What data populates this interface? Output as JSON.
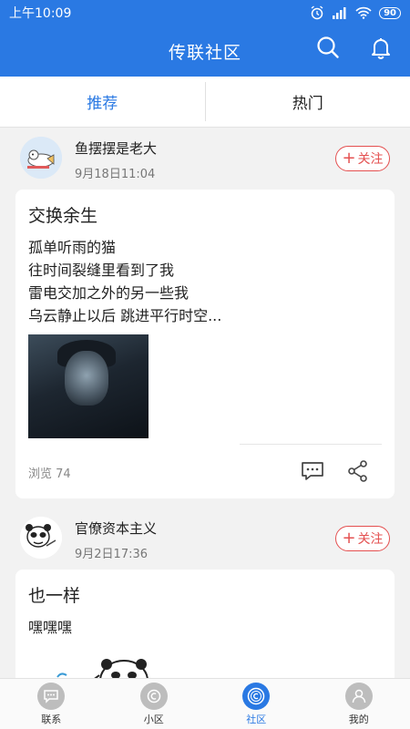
{
  "status": {
    "time": "上午10:09",
    "battery": "90"
  },
  "header": {
    "title": "传联社区"
  },
  "tabs": [
    {
      "label": "推荐",
      "active": true
    },
    {
      "label": "热门",
      "active": false
    }
  ],
  "posts": [
    {
      "author": "鱼摆摆是老大",
      "time": "9月18日11:04",
      "follow_label": "关注",
      "title": "交换余生",
      "lines": [
        "孤单听雨的猫",
        "往时间裂缝里看到了我",
        "雷电交加之外的另一些我",
        "乌云静止以后 跳进平行时空..."
      ],
      "views": "浏览 74"
    },
    {
      "author": "官僚资本主义",
      "time": "9月2日17:36",
      "follow_label": "关注",
      "title": "也一样",
      "lines": [
        "嘿嘿嘿"
      ]
    }
  ],
  "nav": [
    {
      "label": "联系",
      "active": false
    },
    {
      "label": "小区",
      "active": false
    },
    {
      "label": "社区",
      "active": true
    },
    {
      "label": "我的",
      "active": false
    }
  ],
  "colors": {
    "primary": "#2a79e3",
    "follow": "#e45050"
  }
}
